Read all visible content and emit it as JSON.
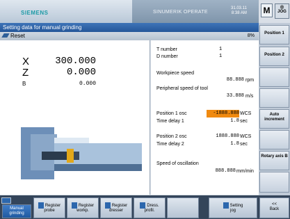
{
  "header": {
    "brand": "SIEMENS",
    "product": "SINUMERIK OPERATE",
    "date": "31.03.11",
    "time": "8:38 AM",
    "mode_icon": "M",
    "jog_label": "JOG"
  },
  "title": "Setting data for manual grinding",
  "reset": {
    "label": "Reset",
    "percent": "8%"
  },
  "axes": [
    {
      "name": "X",
      "value": "300.000"
    },
    {
      "name": "Z",
      "value": "0.000"
    },
    {
      "name": "B",
      "value": "0.000"
    }
  ],
  "tool": {
    "t_label": "T number",
    "t_value": "1",
    "d_label": "D number",
    "d_value": "1"
  },
  "params": {
    "workpiece_speed_label": "Workpiece speed",
    "workpiece_speed_value": "88.888",
    "workpiece_speed_unit": "rpm",
    "peripheral_label": "Peripheral speed of tool",
    "peripheral_value": "33.888",
    "peripheral_unit": "m/s",
    "pos1_label": "Position 1 osc",
    "pos1_value": "-1888.888",
    "pos1_unit": "WCS",
    "delay1_label": "Time delay 1",
    "delay1_value": "1.8",
    "delay1_unit": "sec",
    "pos2_label": "Position 2 osc",
    "pos2_value": "1888.888",
    "pos2_unit": "WCS",
    "delay2_label": "Time delay 2",
    "delay2_value": "1.8",
    "delay2_unit": "sec",
    "osc_speed_label": "Speed of oscillation",
    "osc_speed_value": "888.888",
    "osc_speed_unit": "mm/min"
  },
  "softkeys": [
    "Position 1",
    "Position 2",
    "",
    "",
    "Auto increment",
    "",
    "Rotary axis B",
    "",
    ""
  ],
  "bottom": {
    "k1": "Manual grinding",
    "k2a": "Register",
    "k2b": "probe",
    "k3a": "Register",
    "k3b": "workp.",
    "k4a": "Register",
    "k4b": "dresser",
    "k5a": "Dress.",
    "k5b": "profil.",
    "k6a": "Setting",
    "k6b": "jog",
    "k7a": "<<",
    "k7b": "Back"
  },
  "colors": {
    "highlight": "#f08a10",
    "title_bar": "#245699",
    "brand": "#1d9aa6"
  }
}
